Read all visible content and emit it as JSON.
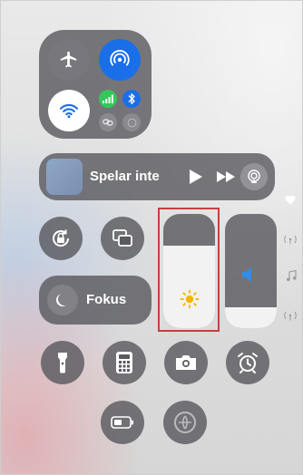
{
  "media": {
    "status_label": "Spelar inte"
  },
  "focus": {
    "label": "Fokus"
  },
  "brightness": {
    "level_fraction": 0.72
  },
  "volume": {
    "level_fraction": 0.18
  },
  "colors": {
    "accent_blue": "#1a6fe8",
    "connection_panel": "#5a5a5e",
    "brightness_fill": "#f2f2f2",
    "sun": "#f5b400",
    "cellular_green": "#34c759",
    "highlight_border": "#c64040"
  },
  "icons": {
    "airplane": "airplane-icon",
    "airdrop": "airdrop-icon",
    "wifi": "wifi-icon",
    "cellular": "cellular-icon",
    "bluetooth": "bluetooth-icon",
    "hotspot": "link-icon",
    "focus": "moon-icon",
    "rotation_lock": "rotation-lock-icon",
    "screen_mirroring": "screen-mirroring-icon",
    "brightness": "sun-icon",
    "volume": "speaker-icon",
    "flashlight": "flashlight-icon",
    "calculator": "calculator-icon",
    "camera": "camera-icon",
    "alarm": "alarm-icon",
    "battery": "battery-icon",
    "accessibility": "accessibility-icon",
    "heart": "heart-icon",
    "signal": "signal-icon",
    "music": "music-note-icon"
  }
}
